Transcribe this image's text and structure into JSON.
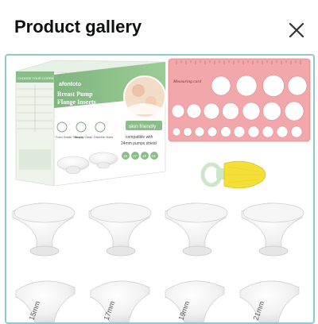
{
  "header": {
    "title": "Product gallery",
    "close_icon": "close-icon"
  },
  "product_image": {
    "box": {
      "brand": "afontoto",
      "title_line1": "Breast Pump",
      "title_line2": "Flange Inserts",
      "badge": "skin friendly",
      "compat_line1": "compatible with",
      "compat_line2": "24mm pumps shield",
      "side_text": "CHOOSE YOUR CORRECT SIZE",
      "features": [
        "Food Grade Silicone",
        "Simply Clean",
        "Discrete Sizes"
      ],
      "sizes": [
        "15",
        "17",
        "19",
        "21"
      ]
    },
    "card": {
      "label": "Measuring card",
      "color": "#f2a7aa"
    },
    "brush": {
      "color": "#f5e03a",
      "ring_color": "#cde6c8"
    },
    "inserts": {
      "size_labels": [
        "15mm",
        "17mm",
        "19mm",
        "21mm"
      ]
    }
  }
}
